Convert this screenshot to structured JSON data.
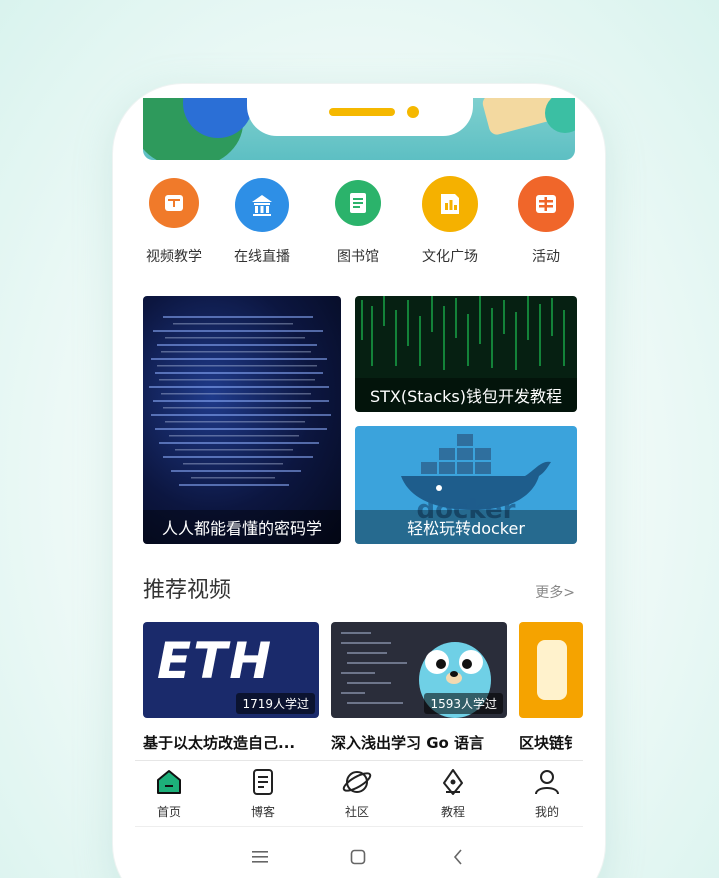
{
  "categories": [
    {
      "label": "视频教学",
      "color": "#f07a2a",
      "icon": "video-teaching-icon"
    },
    {
      "label": "在线直播",
      "color": "#2e8fe6",
      "icon": "live-stream-icon"
    },
    {
      "label": "图书馆",
      "color": "#2bb36b",
      "icon": "library-icon"
    },
    {
      "label": "文化广场",
      "color": "#f5b100",
      "icon": "culture-square-icon"
    },
    {
      "label": "活动",
      "color": "#f0662a",
      "icon": "activity-icon"
    }
  ],
  "featured": [
    {
      "caption": "人人都能看懂的密码学"
    },
    {
      "caption": "STX(Stacks)钱包开发教程"
    },
    {
      "caption": "轻松玩转docker",
      "logo_text": "docker"
    }
  ],
  "section": {
    "title": "推荐视频",
    "more": "更多>"
  },
  "videos": [
    {
      "title": "基于以太坊改造自己...",
      "count": "1719人学过",
      "logo": "ETH"
    },
    {
      "title": "深入浅出学习 Go 语言",
      "count": "1593人学过"
    },
    {
      "title": "区块链钅"
    }
  ],
  "tabs": [
    {
      "label": "首页",
      "icon": "home-icon",
      "active": true
    },
    {
      "label": "博客",
      "icon": "blog-icon"
    },
    {
      "label": "社区",
      "icon": "community-icon"
    },
    {
      "label": "教程",
      "icon": "tutorial-icon"
    },
    {
      "label": "我的",
      "icon": "profile-icon"
    }
  ],
  "colors": {
    "accent": "#1db07a",
    "notch": "#f5b800"
  }
}
